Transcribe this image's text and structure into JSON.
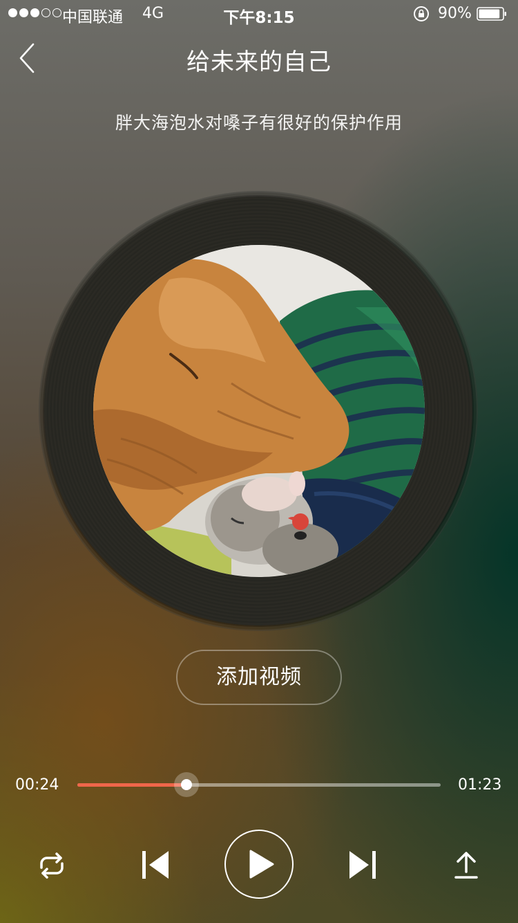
{
  "status_bar": {
    "carrier": "中国联通",
    "network": "4G",
    "time": "下午8:15",
    "battery_percent": "90%",
    "battery_level": 0.9,
    "signal_bars": 3,
    "signal_total": 5
  },
  "nav": {
    "back_icon": "chevron-left-icon",
    "title": "给未来的自己"
  },
  "subtitle": "胖大海泡水对嗓子有很好的保护作用",
  "cover": {
    "subject": "sleeping dog and hamster on green striped blanket"
  },
  "add_video_label": "添加视频",
  "progress": {
    "current": "00:24",
    "total": "01:23",
    "fraction": 0.3,
    "accent_color": "#f0664a"
  },
  "controls": {
    "repeat_icon": "repeat-icon",
    "prev_icon": "skip-previous-icon",
    "play_icon": "play-icon",
    "next_icon": "skip-next-icon",
    "share_icon": "upload-share-icon"
  }
}
